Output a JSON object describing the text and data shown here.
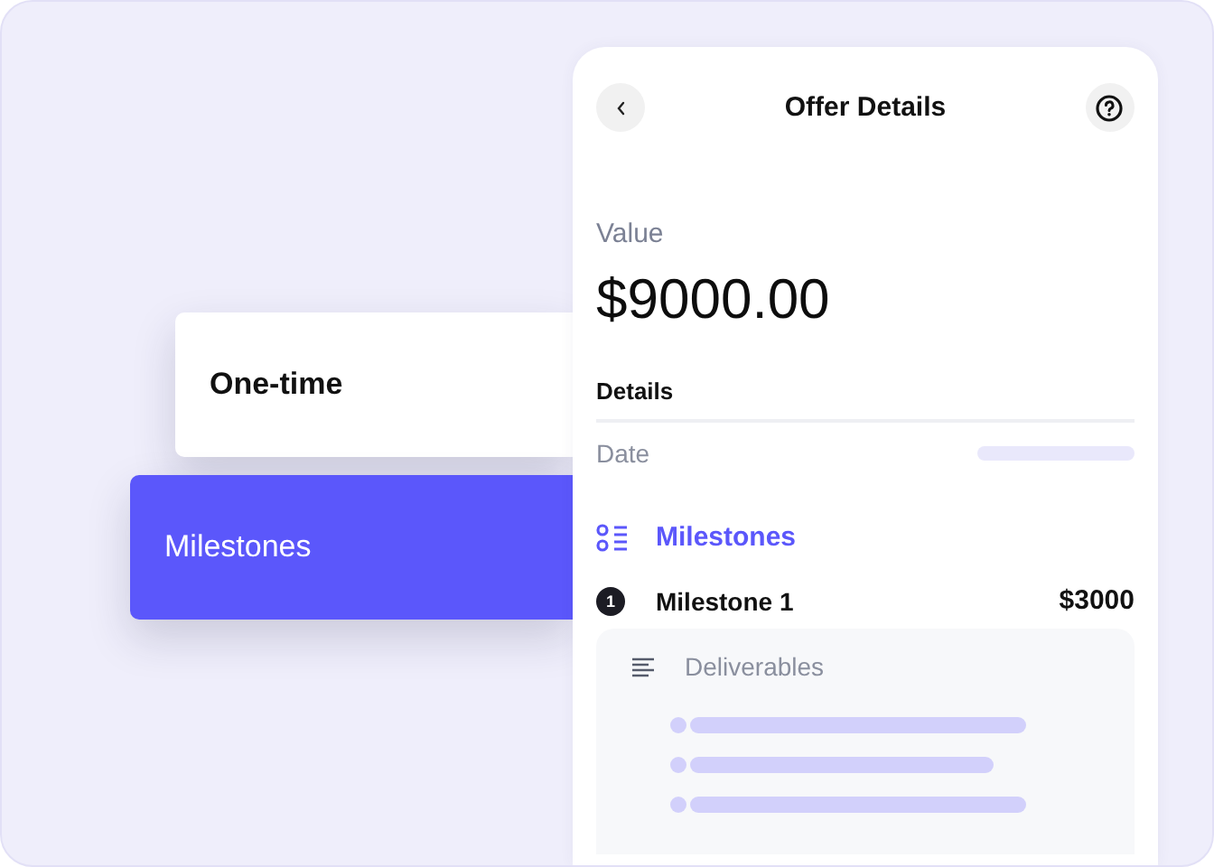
{
  "payment_options": [
    {
      "label": "One-time",
      "selected": false
    },
    {
      "label": "Milestones",
      "selected": true
    }
  ],
  "panel": {
    "title": "Offer Details",
    "value_label": "Value",
    "value": "$9000.00",
    "details_heading": "Details",
    "details": [
      {
        "label": "Date"
      }
    ],
    "milestones_heading": "Milestones",
    "milestones": [
      {
        "number": "1",
        "name": "Milestone 1",
        "amount": "$3000",
        "deliverables_label": "Deliverables"
      }
    ]
  }
}
